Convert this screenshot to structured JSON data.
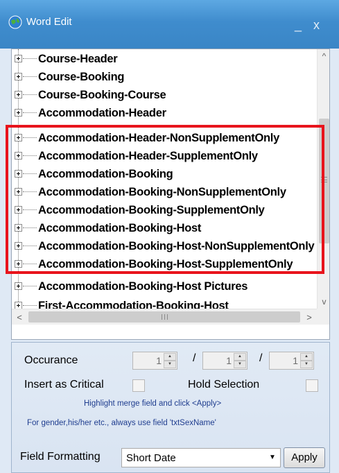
{
  "window": {
    "title": "Word Edit",
    "minimize_glyph": "_",
    "close_glyph": "x"
  },
  "tree": {
    "items": [
      {
        "label": "Course-Header"
      },
      {
        "label": "Course-Booking"
      },
      {
        "label": "Course-Booking-Course"
      },
      {
        "label": "Accommodation-Header"
      },
      {
        "label": "Accommodation-Header-NonSupplementOnly"
      },
      {
        "label": "Accommodation-Header-SupplementOnly"
      },
      {
        "label": "Accommodation-Booking"
      },
      {
        "label": "Accommodation-Booking-NonSupplementOnly"
      },
      {
        "label": "Accommodation-Booking-SupplementOnly"
      },
      {
        "label": "Accommodation-Booking-Host"
      },
      {
        "label": "Accommodation-Booking-Host-NonSupplementOnly"
      },
      {
        "label": "Accommodation-Booking-Host-SupplementOnly"
      },
      {
        "label": "Accommodation-Booking-Host Pictures"
      },
      {
        "label": "First-Accommodation-Booking-Host"
      }
    ],
    "scroll_up_glyph": "^",
    "scroll_down_glyph": "v",
    "scroll_left_glyph": "<",
    "scroll_right_glyph": ">",
    "thumb_grip_glyph": "III",
    "highlight_color": "#e8141c"
  },
  "panel": {
    "occurance_label": "Occurance",
    "occurance_values": [
      "1",
      "1",
      "1"
    ],
    "separator": "/",
    "insert_critical_label": "Insert as Critical",
    "hold_selection_label": "Hold Selection",
    "hint_1": "Highlight merge field and click <Apply>",
    "hint_2": "For gender,his/her etc., always use field 'txtSexName'",
    "field_formatting_label": "Field Formatting",
    "field_formatting_value": "Short Date",
    "apply_label": "Apply"
  },
  "colors": {
    "titlebar": "#3f8ccd",
    "panel_bg": "#dfe9f5",
    "hint_text": "#1f3d8f"
  }
}
